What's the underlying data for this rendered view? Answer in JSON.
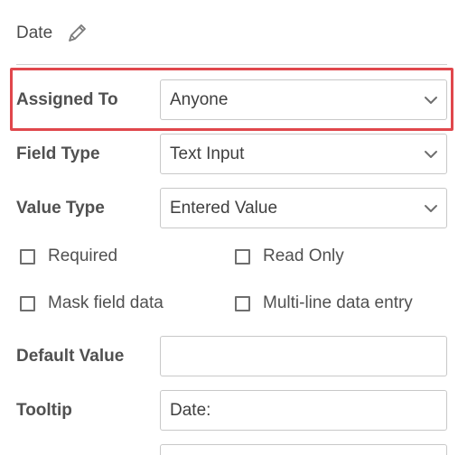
{
  "header": {
    "title": "Date",
    "edit_icon": "pencil-icon"
  },
  "fields": {
    "assigned_to": {
      "label": "Assigned To",
      "value": "Anyone"
    },
    "field_type": {
      "label": "Field Type",
      "value": "Text Input"
    },
    "value_type": {
      "label": "Value Type",
      "value": "Entered Value"
    },
    "default_value": {
      "label": "Default Value",
      "value": ""
    },
    "tooltip": {
      "label": "Tooltip",
      "value": "Date:"
    }
  },
  "options": {
    "required": {
      "label": "Required",
      "checked": false
    },
    "read_only": {
      "label": "Read Only",
      "checked": false
    },
    "mask_field_data": {
      "label": "Mask field data",
      "checked": false
    },
    "multi_line": {
      "label": "Multi-line data entry",
      "checked": false
    }
  },
  "colors": {
    "highlight": "#e0474c",
    "border": "#c8c8c8"
  }
}
